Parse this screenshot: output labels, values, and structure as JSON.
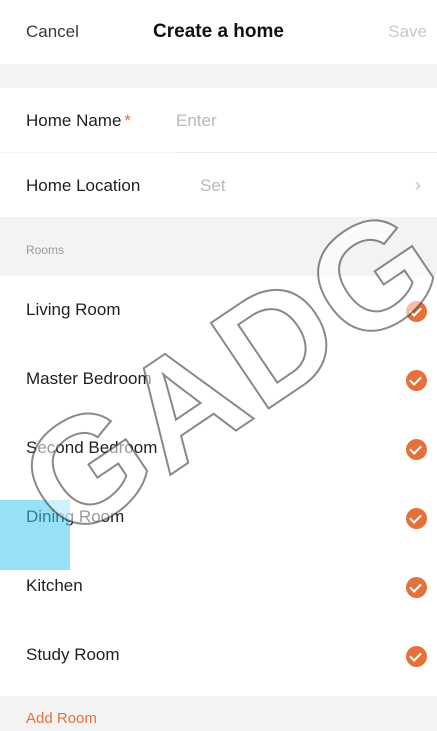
{
  "header": {
    "cancel_label": "Cancel",
    "title": "Create a home",
    "save_label": "Save"
  },
  "form": {
    "home_name_label": "Home Name",
    "home_name_required_mark": "*",
    "home_name_placeholder": "Enter",
    "home_location_label": "Home Location",
    "home_location_value": "Set"
  },
  "rooms_section": {
    "label": "Rooms",
    "rooms": [
      {
        "name": "Living Room",
        "checked": true
      },
      {
        "name": "Master Bedroom",
        "checked": true
      },
      {
        "name": "Second Bedroom",
        "checked": true
      },
      {
        "name": "Dining Room",
        "checked": true
      },
      {
        "name": "Kitchen",
        "checked": true
      },
      {
        "name": "Study Room",
        "checked": true
      }
    ],
    "add_room_label": "Add Room"
  },
  "watermark": "GADG",
  "colors": {
    "accent": "#e6703a",
    "disabled_text": "#c8c8c8",
    "background": "#f3f3f3"
  }
}
